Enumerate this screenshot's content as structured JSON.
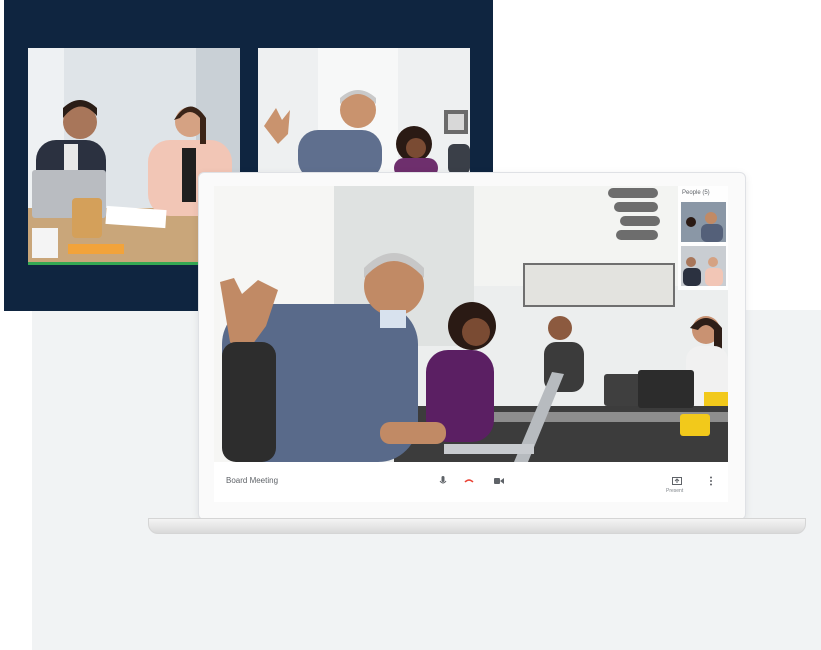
{
  "meeting": {
    "name": "Board Meeting",
    "people_label": "People (5)",
    "present_label": "Present"
  },
  "controls": {
    "mic_icon": "mic-icon",
    "hangup_icon": "hangup-icon",
    "camera_icon": "camera-icon",
    "present_icon": "present-icon",
    "more_icon": "more-vert-icon"
  },
  "colors": {
    "dark_bg": "#0f2540",
    "active_speaker": "#34a853",
    "hangup": "#ea4335"
  }
}
